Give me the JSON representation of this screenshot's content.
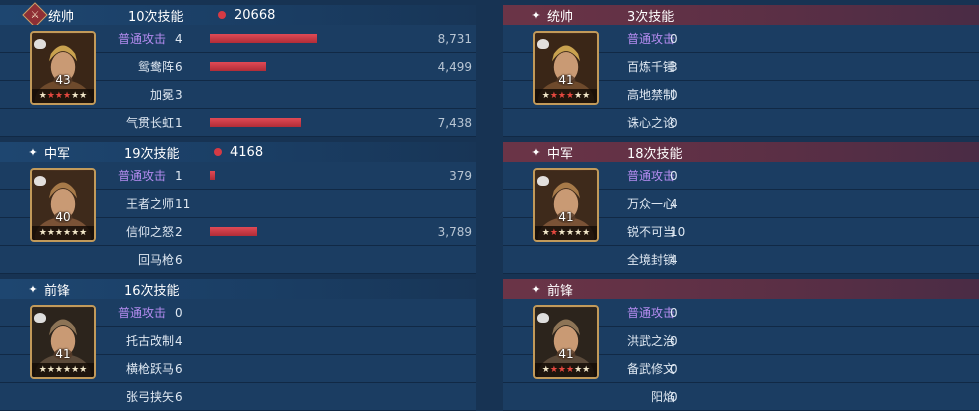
{
  "left": {
    "sections": [
      {
        "role": "统帅",
        "role_icon": "commander-badge-icon",
        "skill_count": "10次技能",
        "damage_total": "20668",
        "avatar": {
          "level": "43",
          "stars": [
            "w",
            "r",
            "r",
            "r",
            "w",
            "w"
          ]
        },
        "rows": [
          {
            "label": "普通攻击",
            "count": "4",
            "damage": "8,731",
            "fill": 0.61,
            "atk": true
          },
          {
            "label": "鸳鸯阵",
            "count": "6",
            "damage": "4,499",
            "fill": 0.32
          },
          {
            "label": "加冕",
            "count": "3",
            "damage": "",
            "fill": 0
          },
          {
            "label": "气贯长虹",
            "count": "1",
            "damage": "7,438",
            "fill": 0.52
          }
        ]
      },
      {
        "role": "中军",
        "role_icon": "sparkle-icon",
        "skill_count": "19次技能",
        "damage_total": "4168",
        "avatar": {
          "level": "40",
          "stars": [
            "w",
            "w",
            "w",
            "w",
            "w",
            "w"
          ]
        },
        "rows": [
          {
            "label": "普通攻击",
            "count": "1",
            "damage": "379",
            "fill": 0.03,
            "atk": true
          },
          {
            "label": "王者之师",
            "count": "11",
            "damage": "",
            "fill": 0
          },
          {
            "label": "信仰之怒",
            "count": "2",
            "damage": "3,789",
            "fill": 0.27
          },
          {
            "label": "回马枪",
            "count": "6",
            "damage": "",
            "fill": 0
          }
        ]
      },
      {
        "role": "前锋",
        "role_icon": "sparkle-icon",
        "skill_count": "16次技能",
        "damage_total": "",
        "avatar": {
          "level": "41",
          "stars": [
            "w",
            "w",
            "w",
            "w",
            "w",
            "w"
          ]
        },
        "rows": [
          {
            "label": "普通攻击",
            "count": "0",
            "damage": "",
            "fill": 0,
            "atk": true
          },
          {
            "label": "托古改制",
            "count": "4",
            "damage": "",
            "fill": 0
          },
          {
            "label": "横枪跃马",
            "count": "6",
            "damage": "",
            "fill": 0
          },
          {
            "label": "张弓挟矢",
            "count": "6",
            "damage": "",
            "fill": 0
          }
        ]
      }
    ]
  },
  "right": {
    "sections": [
      {
        "role": "统帅",
        "role_icon": "sparkle-icon",
        "skill_count": "3次技能",
        "avatar": {
          "level": "41",
          "stars": [
            "w",
            "r",
            "r",
            "r",
            "w",
            "w"
          ]
        },
        "rows": [
          {
            "label": "普通攻击",
            "count": "0",
            "atk": true
          },
          {
            "label": "百炼千锤",
            "count": "3"
          },
          {
            "label": "高地禁制",
            "count": "0"
          },
          {
            "label": "诛心之论",
            "count": "0"
          }
        ]
      },
      {
        "role": "中军",
        "role_icon": "sparkle-icon",
        "skill_count": "18次技能",
        "avatar": {
          "level": "41",
          "stars": [
            "w",
            "r",
            "w",
            "w",
            "w",
            "w"
          ]
        },
        "rows": [
          {
            "label": "普通攻击",
            "count": "0",
            "atk": true
          },
          {
            "label": "万众一心",
            "count": "4"
          },
          {
            "label": "锐不可当",
            "count": "10"
          },
          {
            "label": "全境封锁",
            "count": "4"
          }
        ]
      },
      {
        "role": "前锋",
        "role_icon": "sparkle-icon",
        "skill_count": "",
        "avatar": {
          "level": "41",
          "stars": [
            "w",
            "r",
            "r",
            "r",
            "w",
            "w"
          ]
        },
        "rows": [
          {
            "label": "普通攻击",
            "count": "0",
            "atk": true
          },
          {
            "label": "洪武之治",
            "count": "0"
          },
          {
            "label": "备武修文",
            "count": "0"
          },
          {
            "label": "阳焰",
            "count": "0"
          }
        ]
      }
    ]
  },
  "colors": {
    "background": "#173353",
    "attack_label": "#b48cf0",
    "bar": "#d53a44",
    "enemy_header": "#6b3447"
  }
}
